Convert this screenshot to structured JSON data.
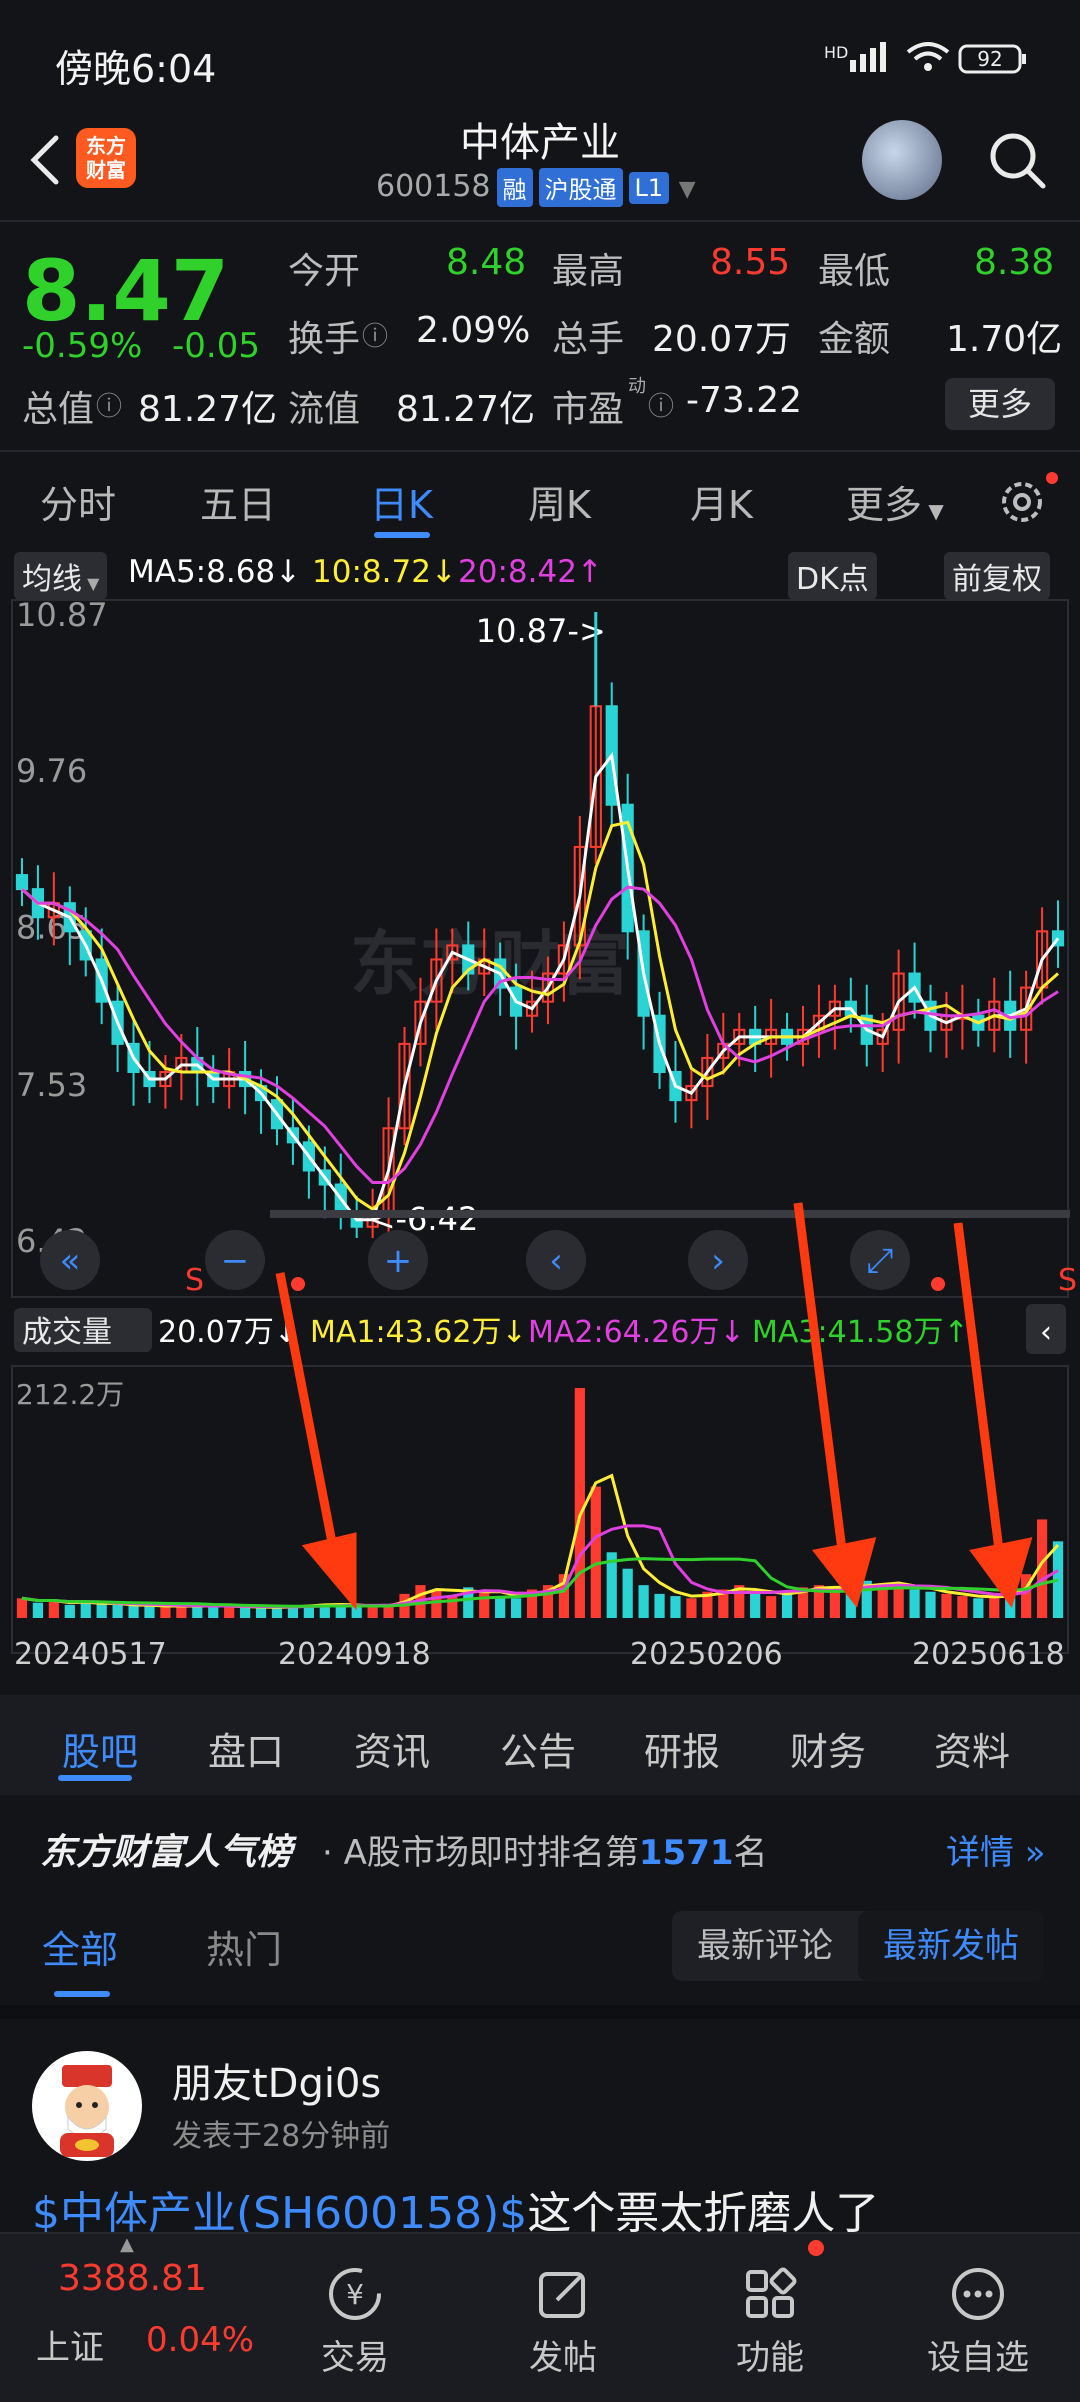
{
  "status_bar": {
    "time": "傍晚6:04",
    "network": "HD",
    "battery": "92"
  },
  "header": {
    "stock_name": "中体产业",
    "stock_code": "600158",
    "badges": [
      "融",
      "沪股通",
      "L1"
    ],
    "logo_text_1": "东方",
    "logo_text_2": "财富"
  },
  "quote": {
    "price": "8.47",
    "change_pct": "-0.59%",
    "change": "-0.05",
    "open_label": "今开",
    "open": "8.48",
    "high_label": "最高",
    "high": "8.55",
    "low_label": "最低",
    "low": "8.38",
    "turnover_label": "换手",
    "turnover": "2.09%",
    "volume_label": "总手",
    "volume": "20.07万",
    "amount_label": "金额",
    "amount": "1.70亿",
    "mktcap_label": "总值",
    "mktcap": "81.27亿",
    "float_label": "流值",
    "float": "81.27亿",
    "pe_label": "市盈",
    "pe_sup": "动",
    "pe": "-73.22",
    "more_label": "更多"
  },
  "period_tabs": [
    "分时",
    "五日",
    "日K",
    "周K",
    "月K",
    "更多"
  ],
  "ma_row": {
    "dropdown": "均线",
    "ma5": "MA5:8.68↓",
    "ma10": "10:8.72↓",
    "ma20": "20:8.42↑",
    "dk": "DK点",
    "adjust": "前复权"
  },
  "chart_data": {
    "type": "candlestick",
    "ylim": [
      6.42,
      10.87
    ],
    "y_ticks": [
      "10.87",
      "9.76",
      "8.65",
      "7.53",
      "6.42"
    ],
    "x_ticks": [
      "20240517",
      "20240918",
      "20250206",
      "20250618"
    ],
    "max_label": "10.87->",
    "min_label": "<-6.42",
    "close_series": [
      8.9,
      8.7,
      8.8,
      8.6,
      8.4,
      8.1,
      7.8,
      7.6,
      7.5,
      7.6,
      7.7,
      7.6,
      7.5,
      7.6,
      7.5,
      7.4,
      7.2,
      7.1,
      6.9,
      6.8,
      6.6,
      6.5,
      6.6,
      7.2,
      7.8,
      8.1,
      8.4,
      8.5,
      8.3,
      8.4,
      8.2,
      8.0,
      8.1,
      8.3,
      8.5,
      9.2,
      10.2,
      9.5,
      8.6,
      8.0,
      7.6,
      7.4,
      7.5,
      7.7,
      7.8,
      7.9,
      7.8,
      7.9,
      7.8,
      7.9,
      8.0,
      8.1,
      8.0,
      7.8,
      7.9,
      8.3,
      8.1,
      7.9,
      8.0,
      8.0,
      7.9,
      8.1,
      7.9,
      8.2,
      8.6,
      8.5
    ],
    "volume_label": "成交量",
    "volume": "20.07万↓",
    "vol_ma1": "MA1:43.62万↓",
    "vol_ma2": "MA2:64.26万↓",
    "vol_ma3": "MA3:41.58万↑",
    "vol_max": "212.2万",
    "volume_series": [
      18,
      14,
      16,
      12,
      15,
      13,
      12,
      11,
      12,
      10,
      11,
      12,
      10,
      11,
      10,
      9,
      10,
      11,
      12,
      13,
      12,
      11,
      10,
      12,
      22,
      30,
      26,
      20,
      28,
      24,
      20,
      18,
      26,
      30,
      40,
      210,
      120,
      60,
      45,
      30,
      22,
      20,
      18,
      24,
      26,
      30,
      22,
      20,
      24,
      28,
      30,
      26,
      28,
      34,
      30,
      32,
      26,
      24,
      22,
      20,
      18,
      20,
      22,
      40,
      90,
      70
    ],
    "watermark": "东方财富"
  },
  "sub_tabs": [
    "股吧",
    "盘口",
    "资讯",
    "公告",
    "研报",
    "财务",
    "资料"
  ],
  "ranking": {
    "title": "东方财富人气榜",
    "text_prefix": "A股市场即时排名第",
    "rank": "1571",
    "text_suffix": "名",
    "detail": "详情"
  },
  "feed_tabs": {
    "all": "全部",
    "hot": "热门",
    "latest_comment": "最新评论",
    "latest_post": "最新发帖"
  },
  "post": {
    "user": "朋友tDgi0s",
    "time": "发表于28分钟前",
    "tag": "$中体产业(SH600158)$",
    "content": "这个票太折磨人了"
  },
  "bottom_nav": {
    "index_value": "3388.81",
    "index_name": "上证",
    "index_change": "0.04%",
    "items": [
      "交易",
      "发帖",
      "功能",
      "设自选"
    ]
  },
  "colors": {
    "up": "#ff3b30",
    "down": "#2fd12a",
    "accent": "#3d8bff",
    "ma5": "#ffffff",
    "ma10": "#ffee33",
    "ma20": "#e040e0"
  }
}
